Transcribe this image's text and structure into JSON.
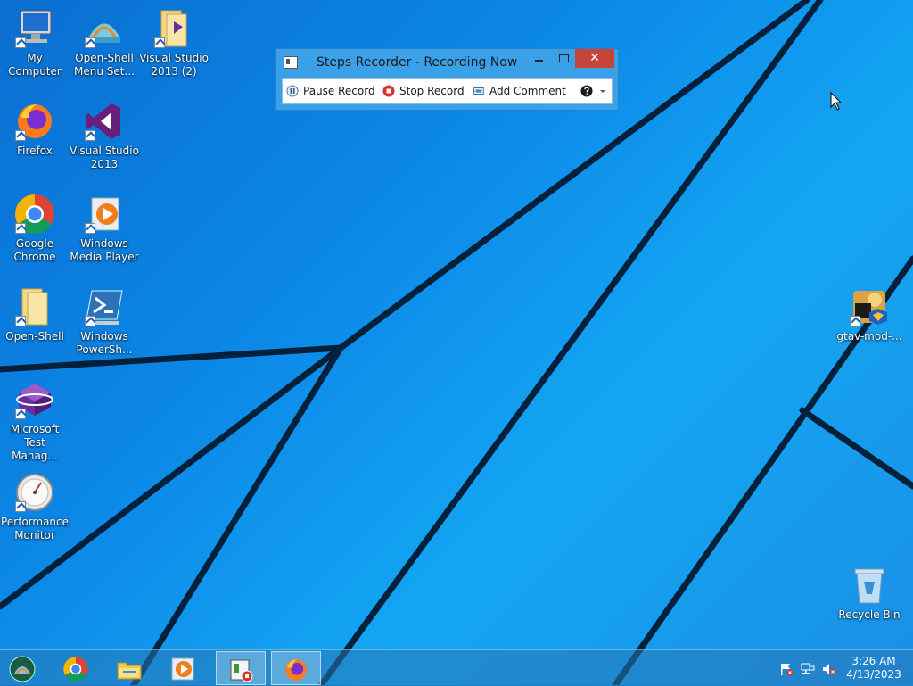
{
  "desktop": {
    "icons": [
      {
        "label": "My Computer",
        "icon": "my-computer-icon"
      },
      {
        "label": "Open-Shell Menu Set...",
        "icon": "open-shell-menu-settings-icon"
      },
      {
        "label": "Visual Studio 2013 (2)",
        "icon": "folder-icon"
      },
      {
        "label": "Firefox",
        "icon": "firefox-icon"
      },
      {
        "label": "Visual Studio 2013",
        "icon": "visual-studio-icon"
      },
      {
        "label": "Google Chrome",
        "icon": "chrome-icon"
      },
      {
        "label": "Windows Media Player",
        "icon": "media-player-icon"
      },
      {
        "label": "Open-Shell",
        "icon": "folder-icon"
      },
      {
        "label": "Windows PowerSh...",
        "icon": "powershell-icon"
      },
      {
        "label": "Microsoft Test Manag...",
        "icon": "test-manager-icon"
      },
      {
        "label": "Performance Monitor",
        "icon": "performance-monitor-icon"
      },
      {
        "label": "gtav-mod-...",
        "icon": "gta-icon"
      },
      {
        "label": "Recycle Bin",
        "icon": "recycle-bin-icon"
      }
    ]
  },
  "steps_recorder": {
    "title": "Steps Recorder - Recording Now",
    "close_glyph": "✕",
    "toolbar": {
      "pause_label": "Pause Record",
      "stop_label": "Stop Record",
      "comment_label": "Add Comment"
    }
  },
  "taskbar": {
    "clock_time": "3:26 AM",
    "clock_date": "4/13/2023"
  },
  "colors": {
    "window_frame": "#3aa0e8",
    "close_button": "#c7443a",
    "stop_icon": "#d9342b"
  }
}
